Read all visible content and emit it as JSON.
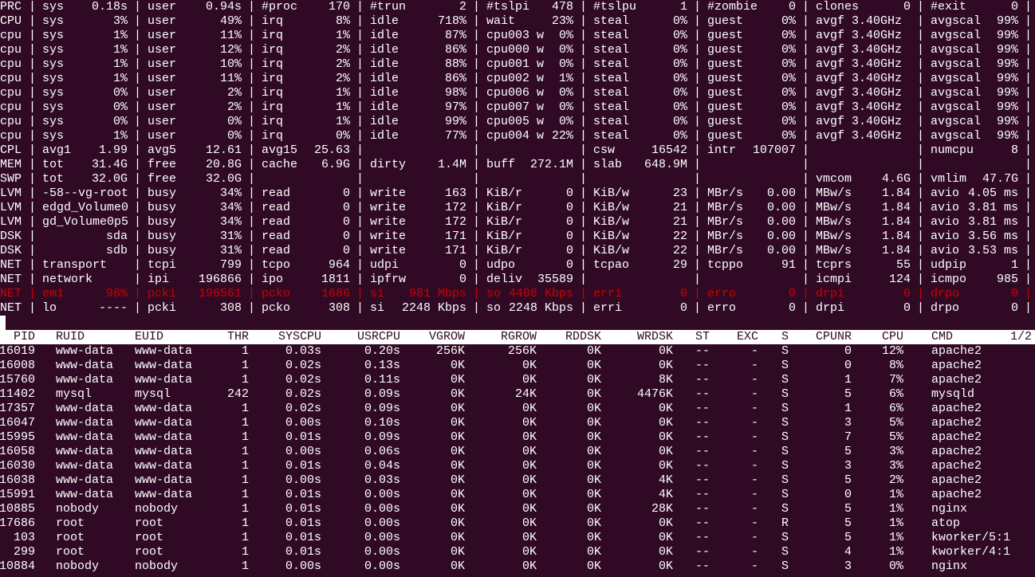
{
  "app": "atop",
  "colors": {
    "background": "#300a24",
    "text": "#ffffff",
    "alert": "#cc0000",
    "header_bg": "#ffffff"
  },
  "separator": "|",
  "system": [
    {
      "label": "PRC",
      "cells": [
        {
          "k": "sys",
          "v": "0.18s"
        },
        {
          "k": "user",
          "v": "0.94s"
        },
        {
          "k": "#proc",
          "v": "170"
        },
        {
          "k": "#trun",
          "v": "2"
        },
        {
          "k": "#tslpi",
          "v": "478"
        },
        {
          "k": "#tslpu",
          "v": "1"
        },
        {
          "k": "#zombie",
          "v": "0"
        },
        {
          "k": "clones",
          "v": "0"
        },
        {
          "k": "#exit",
          "v": "0"
        }
      ]
    },
    {
      "label": "CPU",
      "cells": [
        {
          "k": "sys",
          "v": "3%"
        },
        {
          "k": "user",
          "v": "49%"
        },
        {
          "k": "irq",
          "v": "8%"
        },
        {
          "k": "idle",
          "v": "718%"
        },
        {
          "k": "wait",
          "v": "23%"
        },
        {
          "k": "steal",
          "v": "0%"
        },
        {
          "k": "guest",
          "v": "0%"
        },
        {
          "k": "avgf 3.40GHz",
          "v": ""
        },
        {
          "k": "avgscal",
          "v": "99%"
        }
      ]
    },
    {
      "label": "cpu",
      "cells": [
        {
          "k": "sys",
          "v": "1%"
        },
        {
          "k": "user",
          "v": "11%"
        },
        {
          "k": "irq",
          "v": "1%"
        },
        {
          "k": "idle",
          "v": "87%"
        },
        {
          "k": "cpu003 w",
          "v": "0%"
        },
        {
          "k": "steal",
          "v": "0%"
        },
        {
          "k": "guest",
          "v": "0%"
        },
        {
          "k": "avgf 3.40GHz",
          "v": ""
        },
        {
          "k": "avgscal",
          "v": "99%"
        }
      ]
    },
    {
      "label": "cpu",
      "cells": [
        {
          "k": "sys",
          "v": "1%"
        },
        {
          "k": "user",
          "v": "12%"
        },
        {
          "k": "irq",
          "v": "2%"
        },
        {
          "k": "idle",
          "v": "86%"
        },
        {
          "k": "cpu000 w",
          "v": "0%"
        },
        {
          "k": "steal",
          "v": "0%"
        },
        {
          "k": "guest",
          "v": "0%"
        },
        {
          "k": "avgf 3.40GHz",
          "v": ""
        },
        {
          "k": "avgscal",
          "v": "99%"
        }
      ]
    },
    {
      "label": "cpu",
      "cells": [
        {
          "k": "sys",
          "v": "1%"
        },
        {
          "k": "user",
          "v": "10%"
        },
        {
          "k": "irq",
          "v": "2%"
        },
        {
          "k": "idle",
          "v": "88%"
        },
        {
          "k": "cpu001 w",
          "v": "0%"
        },
        {
          "k": "steal",
          "v": "0%"
        },
        {
          "k": "guest",
          "v": "0%"
        },
        {
          "k": "avgf 3.40GHz",
          "v": ""
        },
        {
          "k": "avgscal",
          "v": "99%"
        }
      ]
    },
    {
      "label": "cpu",
      "cells": [
        {
          "k": "sys",
          "v": "1%"
        },
        {
          "k": "user",
          "v": "11%"
        },
        {
          "k": "irq",
          "v": "2%"
        },
        {
          "k": "idle",
          "v": "86%"
        },
        {
          "k": "cpu002 w",
          "v": "1%"
        },
        {
          "k": "steal",
          "v": "0%"
        },
        {
          "k": "guest",
          "v": "0%"
        },
        {
          "k": "avgf 3.40GHz",
          "v": ""
        },
        {
          "k": "avgscal",
          "v": "99%"
        }
      ]
    },
    {
      "label": "cpu",
      "cells": [
        {
          "k": "sys",
          "v": "0%"
        },
        {
          "k": "user",
          "v": "2%"
        },
        {
          "k": "irq",
          "v": "1%"
        },
        {
          "k": "idle",
          "v": "98%"
        },
        {
          "k": "cpu006 w",
          "v": "0%"
        },
        {
          "k": "steal",
          "v": "0%"
        },
        {
          "k": "guest",
          "v": "0%"
        },
        {
          "k": "avgf 3.40GHz",
          "v": ""
        },
        {
          "k": "avgscal",
          "v": "99%"
        }
      ]
    },
    {
      "label": "cpu",
      "cells": [
        {
          "k": "sys",
          "v": "0%"
        },
        {
          "k": "user",
          "v": "2%"
        },
        {
          "k": "irq",
          "v": "1%"
        },
        {
          "k": "idle",
          "v": "97%"
        },
        {
          "k": "cpu007 w",
          "v": "0%"
        },
        {
          "k": "steal",
          "v": "0%"
        },
        {
          "k": "guest",
          "v": "0%"
        },
        {
          "k": "avgf 3.40GHz",
          "v": ""
        },
        {
          "k": "avgscal",
          "v": "99%"
        }
      ]
    },
    {
      "label": "cpu",
      "cells": [
        {
          "k": "sys",
          "v": "0%"
        },
        {
          "k": "user",
          "v": "0%"
        },
        {
          "k": "irq",
          "v": "1%"
        },
        {
          "k": "idle",
          "v": "99%"
        },
        {
          "k": "cpu005 w",
          "v": "0%"
        },
        {
          "k": "steal",
          "v": "0%"
        },
        {
          "k": "guest",
          "v": "0%"
        },
        {
          "k": "avgf 3.40GHz",
          "v": ""
        },
        {
          "k": "avgscal",
          "v": "99%"
        }
      ]
    },
    {
      "label": "cpu",
      "cells": [
        {
          "k": "sys",
          "v": "1%"
        },
        {
          "k": "user",
          "v": "0%"
        },
        {
          "k": "irq",
          "v": "0%"
        },
        {
          "k": "idle",
          "v": "77%"
        },
        {
          "k": "cpu004 w",
          "v": "22%"
        },
        {
          "k": "steal",
          "v": "0%"
        },
        {
          "k": "guest",
          "v": "0%"
        },
        {
          "k": "avgf 3.40GHz",
          "v": ""
        },
        {
          "k": "avgscal",
          "v": "99%"
        }
      ]
    },
    {
      "label": "CPL",
      "cells": [
        {
          "k": "avg1",
          "v": "1.99"
        },
        {
          "k": "avg5",
          "v": "12.61"
        },
        {
          "k": "avg15",
          "v": "25.63"
        },
        null,
        null,
        {
          "k": "csw",
          "v": "16542"
        },
        {
          "k": "intr",
          "v": "107007"
        },
        null,
        {
          "k": "numcpu",
          "v": "8"
        }
      ]
    },
    {
      "label": "MEM",
      "cells": [
        {
          "k": "tot",
          "v": "31.4G"
        },
        {
          "k": "free",
          "v": "20.8G"
        },
        {
          "k": "cache",
          "v": "6.9G"
        },
        {
          "k": "dirty",
          "v": "1.4M"
        },
        {
          "k": "buff",
          "v": "272.1M"
        },
        {
          "k": "slab",
          "v": "648.9M"
        },
        null,
        null,
        null
      ]
    },
    {
      "label": "SWP",
      "cells": [
        {
          "k": "tot",
          "v": "32.0G"
        },
        {
          "k": "free",
          "v": "32.0G"
        },
        null,
        null,
        null,
        null,
        null,
        {
          "k": "vmcom",
          "v": "4.6G"
        },
        {
          "k": "vmlim",
          "v": "47.7G"
        }
      ]
    },
    {
      "label": "LVM",
      "cells": [
        {
          "k": "-58--vg-root",
          "v": ""
        },
        {
          "k": "busy",
          "v": "34%"
        },
        {
          "k": "read",
          "v": "0"
        },
        {
          "k": "write",
          "v": "163"
        },
        {
          "k": "KiB/r",
          "v": "0"
        },
        {
          "k": "KiB/w",
          "v": "23"
        },
        {
          "k": "MBr/s",
          "v": "0.00"
        },
        {
          "k": "MBw/s",
          "v": "1.84"
        },
        {
          "k": "avio",
          "v": "4.05 ms"
        }
      ]
    },
    {
      "label": "LVM",
      "cells": [
        {
          "k": "edgd_Volume0",
          "v": ""
        },
        {
          "k": "busy",
          "v": "34%"
        },
        {
          "k": "read",
          "v": "0"
        },
        {
          "k": "write",
          "v": "172"
        },
        {
          "k": "KiB/r",
          "v": "0"
        },
        {
          "k": "KiB/w",
          "v": "21"
        },
        {
          "k": "MBr/s",
          "v": "0.00"
        },
        {
          "k": "MBw/s",
          "v": "1.84"
        },
        {
          "k": "avio",
          "v": "3.81 ms"
        }
      ]
    },
    {
      "label": "LVM",
      "cells": [
        {
          "k": "gd_Volume0p5",
          "v": ""
        },
        {
          "k": "busy",
          "v": "34%"
        },
        {
          "k": "read",
          "v": "0"
        },
        {
          "k": "write",
          "v": "172"
        },
        {
          "k": "KiB/r",
          "v": "0"
        },
        {
          "k": "KiB/w",
          "v": "21"
        },
        {
          "k": "MBr/s",
          "v": "0.00"
        },
        {
          "k": "MBw/s",
          "v": "1.84"
        },
        {
          "k": "avio",
          "v": "3.81 ms"
        }
      ]
    },
    {
      "label": "DSK",
      "cells": [
        {
          "k": "",
          "v": "sda"
        },
        {
          "k": "busy",
          "v": "31%"
        },
        {
          "k": "read",
          "v": "0"
        },
        {
          "k": "write",
          "v": "171"
        },
        {
          "k": "KiB/r",
          "v": "0"
        },
        {
          "k": "KiB/w",
          "v": "22"
        },
        {
          "k": "MBr/s",
          "v": "0.00"
        },
        {
          "k": "MBw/s",
          "v": "1.84"
        },
        {
          "k": "avio",
          "v": "3.56 ms"
        }
      ]
    },
    {
      "label": "DSK",
      "cells": [
        {
          "k": "",
          "v": "sdb"
        },
        {
          "k": "busy",
          "v": "31%"
        },
        {
          "k": "read",
          "v": "0"
        },
        {
          "k": "write",
          "v": "171"
        },
        {
          "k": "KiB/r",
          "v": "0"
        },
        {
          "k": "KiB/w",
          "v": "22"
        },
        {
          "k": "MBr/s",
          "v": "0.00"
        },
        {
          "k": "MBw/s",
          "v": "1.84"
        },
        {
          "k": "avio",
          "v": "3.53 ms"
        }
      ]
    },
    {
      "label": "NET",
      "cells": [
        {
          "k": "transport",
          "v": ""
        },
        {
          "k": "tcpi",
          "v": "799"
        },
        {
          "k": "tcpo",
          "v": "964"
        },
        {
          "k": "udpi",
          "v": "0"
        },
        {
          "k": "udpo",
          "v": "0"
        },
        {
          "k": "tcpao",
          "v": "29"
        },
        {
          "k": "tcppo",
          "v": "91"
        },
        {
          "k": "tcprs",
          "v": "55"
        },
        {
          "k": "udpip",
          "v": "1"
        }
      ]
    },
    {
      "label": "NET",
      "cells": [
        {
          "k": "network",
          "v": ""
        },
        {
          "k": "ipi",
          "v": "196866"
        },
        {
          "k": "ipo",
          "v": "1811"
        },
        {
          "k": "ipfrw",
          "v": "0"
        },
        {
          "k": "deliv",
          "v": "35589"
        },
        null,
        null,
        {
          "k": "icmpi",
          "v": "124"
        },
        {
          "k": "icmpo",
          "v": "985"
        }
      ]
    },
    {
      "label": "NET",
      "alert": true,
      "cells": [
        {
          "k": "em1",
          "v": "98%"
        },
        {
          "k": "pcki",
          "v": "196561"
        },
        {
          "k": "pcko",
          "v": "1686"
        },
        {
          "k": "si",
          "v": "981 Mbps"
        },
        {
          "k": "so",
          "v": "4408 Kbps"
        },
        {
          "k": "erri",
          "v": "0"
        },
        {
          "k": "erro",
          "v": "0"
        },
        {
          "k": "drpi",
          "v": "0"
        },
        {
          "k": "drpo",
          "v": "0"
        }
      ]
    },
    {
      "label": "NET",
      "cells": [
        {
          "k": "lo",
          "v": "----"
        },
        {
          "k": "pcki",
          "v": "308"
        },
        {
          "k": "pcko",
          "v": "308"
        },
        {
          "k": "si",
          "v": "2248 Kbps"
        },
        {
          "k": "so",
          "v": "2248 Kbps"
        },
        {
          "k": "erri",
          "v": "0"
        },
        {
          "k": "erro",
          "v": "0"
        },
        {
          "k": "drpi",
          "v": "0"
        },
        {
          "k": "drpo",
          "v": "0"
        }
      ]
    }
  ],
  "processes": {
    "columns": [
      "PID",
      "RUID",
      "EUID",
      "THR",
      "SYSCPU",
      "USRCPU",
      "VGROW",
      "RGROW",
      "RDDSK",
      "WRDSK",
      "ST",
      "EXC",
      "S",
      "CPUNR",
      "CPU",
      "CMD"
    ],
    "page": "1/2",
    "rows": [
      [
        "16019",
        "www-data",
        "www-data",
        "1",
        "0.03s",
        "0.20s",
        "256K",
        "256K",
        "0K",
        "0K",
        "--",
        "-",
        "S",
        "0",
        "12%",
        "apache2"
      ],
      [
        "16008",
        "www-data",
        "www-data",
        "1",
        "0.02s",
        "0.13s",
        "0K",
        "0K",
        "0K",
        "0K",
        "--",
        "-",
        "S",
        "0",
        "8%",
        "apache2"
      ],
      [
        "15760",
        "www-data",
        "www-data",
        "1",
        "0.02s",
        "0.11s",
        "0K",
        "0K",
        "0K",
        "8K",
        "--",
        "-",
        "S",
        "1",
        "7%",
        "apache2"
      ],
      [
        "11402",
        "mysql",
        "mysql",
        "242",
        "0.02s",
        "0.09s",
        "0K",
        "24K",
        "0K",
        "4476K",
        "--",
        "-",
        "S",
        "5",
        "6%",
        "mysqld"
      ],
      [
        "17357",
        "www-data",
        "www-data",
        "1",
        "0.02s",
        "0.09s",
        "0K",
        "0K",
        "0K",
        "0K",
        "--",
        "-",
        "S",
        "1",
        "6%",
        "apache2"
      ],
      [
        "16047",
        "www-data",
        "www-data",
        "1",
        "0.00s",
        "0.10s",
        "0K",
        "0K",
        "0K",
        "0K",
        "--",
        "-",
        "S",
        "3",
        "5%",
        "apache2"
      ],
      [
        "15995",
        "www-data",
        "www-data",
        "1",
        "0.01s",
        "0.09s",
        "0K",
        "0K",
        "0K",
        "0K",
        "--",
        "-",
        "S",
        "7",
        "5%",
        "apache2"
      ],
      [
        "16058",
        "www-data",
        "www-data",
        "1",
        "0.00s",
        "0.06s",
        "0K",
        "0K",
        "0K",
        "0K",
        "--",
        "-",
        "S",
        "5",
        "3%",
        "apache2"
      ],
      [
        "16030",
        "www-data",
        "www-data",
        "1",
        "0.01s",
        "0.04s",
        "0K",
        "0K",
        "0K",
        "0K",
        "--",
        "-",
        "S",
        "3",
        "3%",
        "apache2"
      ],
      [
        "16038",
        "www-data",
        "www-data",
        "1",
        "0.00s",
        "0.03s",
        "0K",
        "0K",
        "0K",
        "4K",
        "--",
        "-",
        "S",
        "5",
        "2%",
        "apache2"
      ],
      [
        "15991",
        "www-data",
        "www-data",
        "1",
        "0.01s",
        "0.00s",
        "0K",
        "0K",
        "0K",
        "4K",
        "--",
        "-",
        "S",
        "0",
        "1%",
        "apache2"
      ],
      [
        "10885",
        "nobody",
        "nobody",
        "1",
        "0.01s",
        "0.00s",
        "0K",
        "0K",
        "0K",
        "28K",
        "--",
        "-",
        "S",
        "5",
        "1%",
        "nginx"
      ],
      [
        "17686",
        "root",
        "root",
        "1",
        "0.01s",
        "0.00s",
        "0K",
        "0K",
        "0K",
        "0K",
        "--",
        "-",
        "R",
        "5",
        "1%",
        "atop"
      ],
      [
        "103",
        "root",
        "root",
        "1",
        "0.01s",
        "0.00s",
        "0K",
        "0K",
        "0K",
        "0K",
        "--",
        "-",
        "S",
        "5",
        "1%",
        "kworker/5:1"
      ],
      [
        "299",
        "root",
        "root",
        "1",
        "0.01s",
        "0.00s",
        "0K",
        "0K",
        "0K",
        "0K",
        "--",
        "-",
        "S",
        "4",
        "1%",
        "kworker/4:1"
      ],
      [
        "10884",
        "nobody",
        "nobody",
        "1",
        "0.00s",
        "0.00s",
        "0K",
        "0K",
        "0K",
        "0K",
        "--",
        "-",
        "S",
        "3",
        "0%",
        "nginx"
      ]
    ]
  }
}
